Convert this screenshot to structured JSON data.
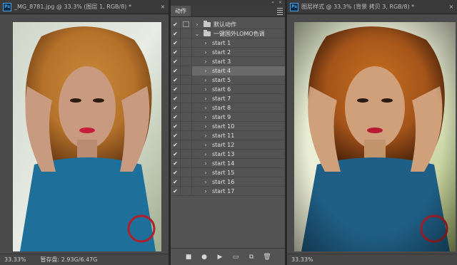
{
  "left_window": {
    "title": "_MG_8781.jpg @ 33.3% (图层 1, RGB/8) *",
    "zoom": "33.33%",
    "scratch": "暂存盘: 2.93G/6.47G",
    "close_glyph": "×"
  },
  "right_window": {
    "title": "图层样式 @ 33.3% (背景 拷贝 3, RGB/8) *",
    "zoom": "33.33%",
    "close_glyph": "×"
  },
  "app_icon": "Ps",
  "actions_panel": {
    "tab_label": "动作",
    "top_controls": [
      "«",
      "×"
    ],
    "rows": [
      {
        "check": "✔",
        "dialog": true,
        "chevron": "›",
        "folder": true,
        "label": "默认动作",
        "indent": 0,
        "selected": false
      },
      {
        "check": "✔",
        "dialog": false,
        "chevron": "⌄",
        "folder": true,
        "label": "一键国外LOMO色调",
        "indent": 0,
        "selected": false
      },
      {
        "check": "✔",
        "dialog": false,
        "chevron": "›",
        "folder": false,
        "label": "start 1",
        "indent": 1,
        "selected": false
      },
      {
        "check": "✔",
        "dialog": false,
        "chevron": "›",
        "folder": false,
        "label": "start 2",
        "indent": 1,
        "selected": false
      },
      {
        "check": "✔",
        "dialog": false,
        "chevron": "›",
        "folder": false,
        "label": "start 3",
        "indent": 1,
        "selected": false
      },
      {
        "check": "✔",
        "dialog": false,
        "chevron": "›",
        "folder": false,
        "label": "start 4",
        "indent": 1,
        "selected": true
      },
      {
        "check": "✔",
        "dialog": false,
        "chevron": "›",
        "folder": false,
        "label": "start 5",
        "indent": 1,
        "selected": false
      },
      {
        "check": "✔",
        "dialog": false,
        "chevron": "›",
        "folder": false,
        "label": "start 6",
        "indent": 1,
        "selected": false
      },
      {
        "check": "✔",
        "dialog": false,
        "chevron": "›",
        "folder": false,
        "label": "start 7",
        "indent": 1,
        "selected": false
      },
      {
        "check": "✔",
        "dialog": false,
        "chevron": "›",
        "folder": false,
        "label": "start 8",
        "indent": 1,
        "selected": false
      },
      {
        "check": "✔",
        "dialog": false,
        "chevron": "›",
        "folder": false,
        "label": "start 9",
        "indent": 1,
        "selected": false
      },
      {
        "check": "✔",
        "dialog": false,
        "chevron": "›",
        "folder": false,
        "label": "start 10",
        "indent": 1,
        "selected": false
      },
      {
        "check": "✔",
        "dialog": false,
        "chevron": "›",
        "folder": false,
        "label": "start 11",
        "indent": 1,
        "selected": false
      },
      {
        "check": "✔",
        "dialog": false,
        "chevron": "›",
        "folder": false,
        "label": "start 12",
        "indent": 1,
        "selected": false
      },
      {
        "check": "✔",
        "dialog": false,
        "chevron": "›",
        "folder": false,
        "label": "start 13",
        "indent": 1,
        "selected": false
      },
      {
        "check": "✔",
        "dialog": false,
        "chevron": "›",
        "folder": false,
        "label": "start 14",
        "indent": 1,
        "selected": false
      },
      {
        "check": "✔",
        "dialog": false,
        "chevron": "›",
        "folder": false,
        "label": "start 15",
        "indent": 1,
        "selected": false
      },
      {
        "check": "✔",
        "dialog": false,
        "chevron": "›",
        "folder": false,
        "label": "start 16",
        "indent": 1,
        "selected": false
      },
      {
        "check": "✔",
        "dialog": false,
        "chevron": "›",
        "folder": false,
        "label": "start 17",
        "indent": 1,
        "selected": false
      }
    ],
    "bottom_buttons": [
      {
        "name": "stop-recording-button",
        "icon": "stop-icon",
        "glyph": "■"
      },
      {
        "name": "start-recording-button",
        "icon": "record-icon",
        "glyph": "●"
      },
      {
        "name": "play-selection-button",
        "icon": "play-icon",
        "glyph": "▶"
      },
      {
        "name": "create-new-set-button",
        "icon": "folder-icon",
        "glyph": "▭"
      },
      {
        "name": "create-new-action-button",
        "icon": "new-action-icon",
        "glyph": "⧉"
      },
      {
        "name": "delete-button",
        "icon": "trash-icon",
        "glyph": "🗑"
      }
    ]
  },
  "colors": {
    "app_bg": "#282828",
    "panel_bg": "#535353",
    "selected_row": "#6a6a6a",
    "accent": "#4aa3e8"
  }
}
